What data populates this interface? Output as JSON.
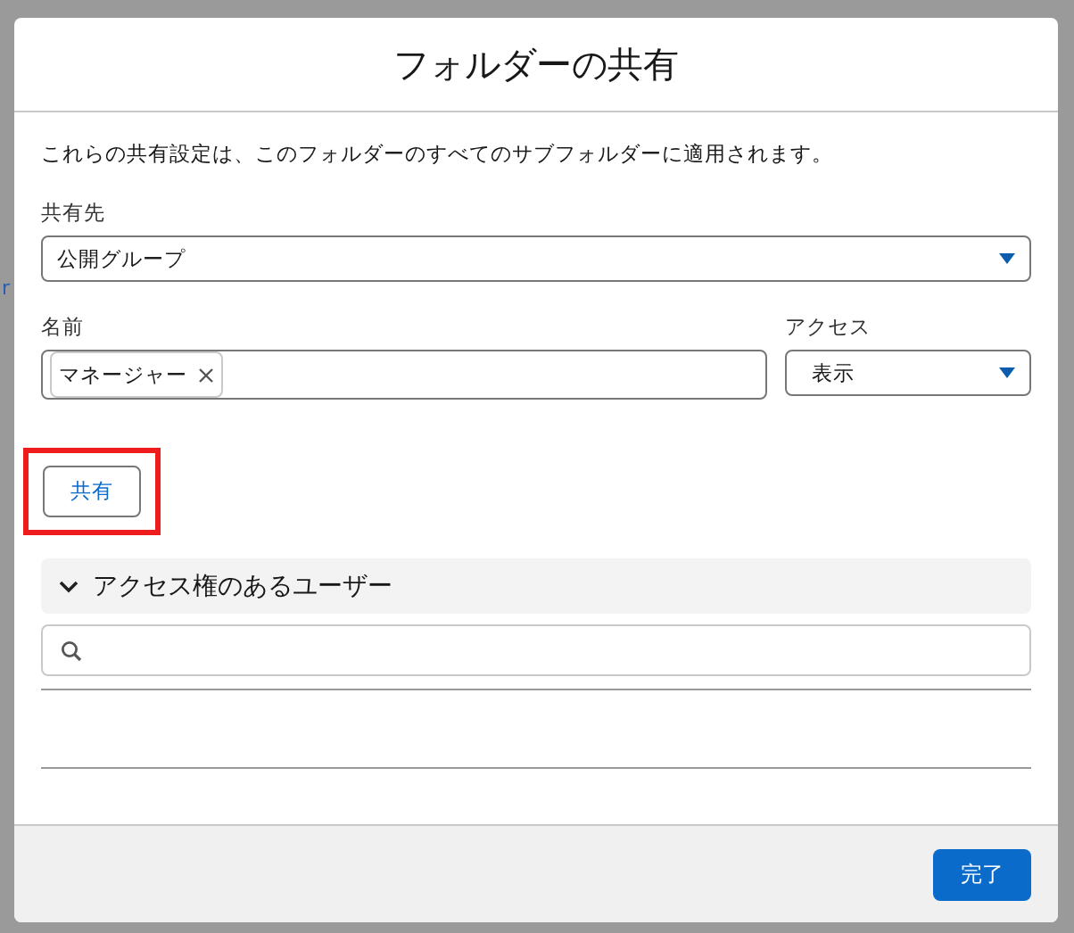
{
  "background": {
    "cut_text": "r"
  },
  "dialog": {
    "title": "フォルダーの共有",
    "description": "これらの共有設定は、このフォルダーのすべてのサブフォルダーに適用されます。",
    "share_with": {
      "label": "共有先",
      "value": "公開グループ"
    },
    "name": {
      "label": "名前",
      "pills": [
        {
          "label": "マネージャー"
        }
      ]
    },
    "access": {
      "label": "アクセス",
      "value": "表示"
    },
    "share_button": {
      "label": "共有",
      "highlighted": true
    },
    "users_section": {
      "title": "アクセス権のあるユーザー",
      "expanded": true
    },
    "done_button": {
      "label": "完了"
    }
  }
}
